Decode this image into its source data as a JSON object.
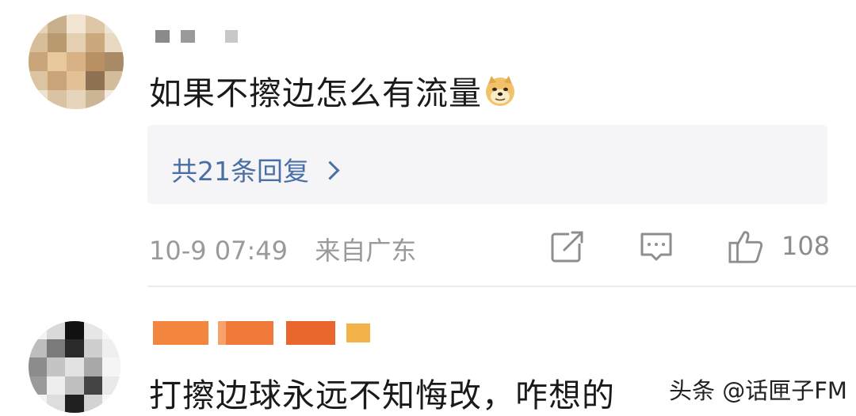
{
  "comments": [
    {
      "text": "如果不擦边怎么有流量",
      "emoji": "doge-emoji",
      "replies_label": "共21条回复",
      "time": "10-9 07:49",
      "location": "来自广东",
      "actions": {
        "share_icon": "share-square-icon",
        "comment_icon": "comment-bubble-icon",
        "like_icon": "thumbs-up-icon",
        "like_count": "108"
      }
    },
    {
      "text": "打擦边球永远不知悔改，咋想的"
    }
  ],
  "watermark": "头条 @话匣子FM",
  "colors": {
    "link": "#4a6fa5",
    "meta": "#9a9a9a",
    "reply_bg": "#f5f5f7",
    "name_mosaic": "#f07a3a"
  }
}
